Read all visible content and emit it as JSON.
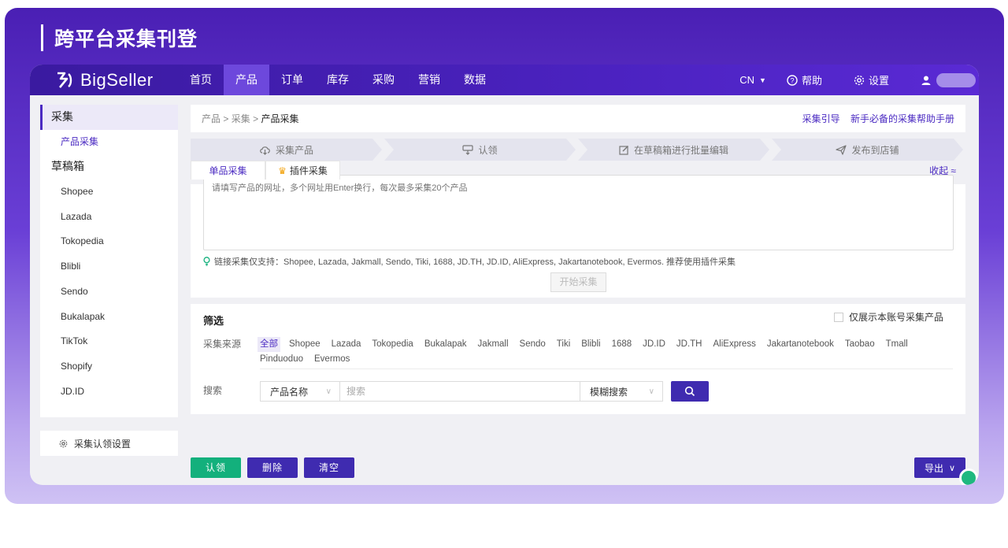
{
  "banner": {
    "title": "跨平台采集刊登"
  },
  "topnav": {
    "logo": "BigSeller",
    "items": [
      {
        "label": "首页"
      },
      {
        "label": "产品",
        "active": true
      },
      {
        "label": "订单"
      },
      {
        "label": "库存"
      },
      {
        "label": "采购"
      },
      {
        "label": "营销"
      },
      {
        "label": "数据"
      }
    ],
    "lang": "CN",
    "help": "帮助",
    "settings": "设置"
  },
  "sidebar": {
    "group1": "采集",
    "group1_item": "产品采集",
    "group2": "草稿箱",
    "platforms": [
      "Shopee",
      "Lazada",
      "Tokopedia",
      "Blibli",
      "Sendo",
      "Bukalapak",
      "TikTok",
      "Shopify",
      "JD.ID"
    ],
    "settings": "采集认领设置"
  },
  "breadcrumb": {
    "part1": "产品",
    "sep": ">",
    "part2": "采集",
    "current": "产品采集",
    "link1": "采集引导",
    "link2": "新手必备的采集帮助手册"
  },
  "steps": [
    "采集产品",
    "认领",
    "在草稿箱进行批量编辑",
    "发布到店铺"
  ],
  "collect": {
    "tab1": "单品采集",
    "tab2": "插件采集",
    "collapse": "收起 ≈",
    "placeholder": "请填写产品的网址，多个网址用Enter换行，每次最多采集20个产品",
    "hint": "链接采集仅支持：Shopee, Lazada, Jakmall, Sendo, Tiki, 1688, JD.TH, JD.ID, AliExpress, Jakartanotebook, Evermos. 推荐使用插件采集",
    "start": "开始采集"
  },
  "filter": {
    "title": "筛选",
    "only_own": "仅展示本账号采集产品",
    "source_label": "采集来源",
    "sources": [
      "全部",
      "Shopee",
      "Lazada",
      "Tokopedia",
      "Bukalapak",
      "Jakmall",
      "Sendo",
      "Tiki",
      "Blibli",
      "1688",
      "JD.ID",
      "JD.TH",
      "AliExpress",
      "Jakartanotebook",
      "Taobao",
      "Tmall",
      "Pinduoduo",
      "Evermos"
    ],
    "search_label": "搜索",
    "field_select": "产品名称",
    "search_placeholder": "搜索",
    "mode_select": "模糊搜索"
  },
  "actions": {
    "claim": "认领",
    "delete": "删除",
    "clear": "清空",
    "export": "导出"
  },
  "colors": {
    "brand": "#4b22c0",
    "accent": "#3f2bb0",
    "green": "#13b07c"
  }
}
